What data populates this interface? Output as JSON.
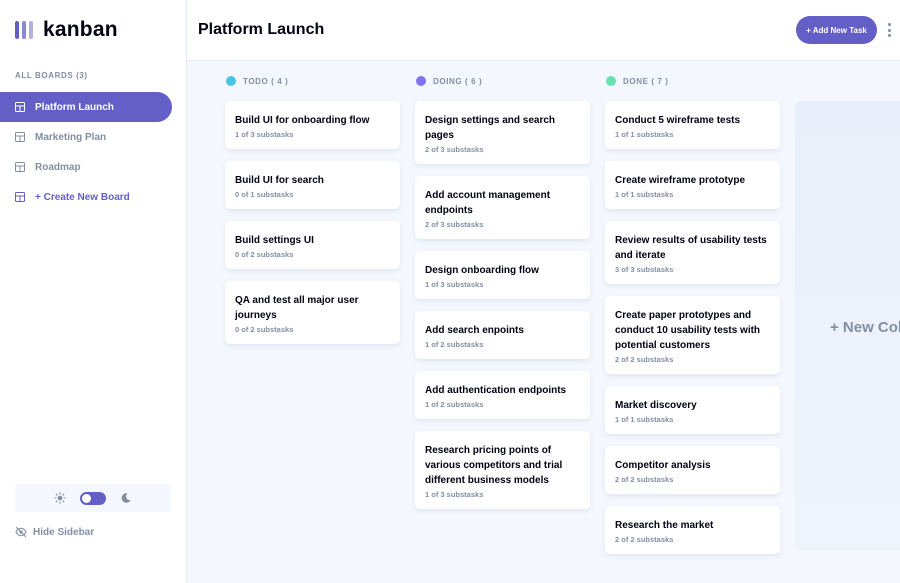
{
  "app": {
    "logo_text": "kanban"
  },
  "sidebar": {
    "boards_heading": "ALL BOARDS (3)",
    "boards": [
      {
        "label": "Platform Launch",
        "active": true
      },
      {
        "label": "Marketing Plan",
        "active": false
      },
      {
        "label": "Roadmap",
        "active": false
      }
    ],
    "create_label": "+ Create New Board",
    "hide_label": "Hide Sidebar"
  },
  "header": {
    "title": "Platform Launch",
    "add_task_label": "+ Add New Task"
  },
  "theme": {
    "mode": "light"
  },
  "columns": [
    {
      "title": "TODO ( 4 )",
      "color": "#49C4E5",
      "cards": [
        {
          "title": "Build UI for onboarding flow",
          "subtasks": "1 of 3 substasks"
        },
        {
          "title": "Build UI for search",
          "subtasks": "0 of 1 substasks"
        },
        {
          "title": "Build settings UI",
          "subtasks": "0 of 2 substasks"
        },
        {
          "title": "QA and test all major user journeys",
          "subtasks": "0 of 2 substasks"
        }
      ]
    },
    {
      "title": "DOING ( 6 )",
      "color": "#8471F2",
      "cards": [
        {
          "title": "Design settings and search pages",
          "subtasks": "2 of 3 substasks"
        },
        {
          "title": "Add account management endpoints",
          "subtasks": "2 of 3 substasks"
        },
        {
          "title": "Design onboarding flow",
          "subtasks": "1 of 3 substasks"
        },
        {
          "title": "Add search enpoints",
          "subtasks": "1 of 2 substasks"
        },
        {
          "title": "Add authentication endpoints",
          "subtasks": "1 of 2 substasks"
        },
        {
          "title": "Research pricing points of various competitors and trial different business models",
          "subtasks": "1 of 3 substasks"
        }
      ]
    },
    {
      "title": "DONE ( 7 )",
      "color": "#67E2AE",
      "cards": [
        {
          "title": "Conduct 5 wireframe tests",
          "subtasks": "1 of 1 substasks"
        },
        {
          "title": "Create wireframe prototype",
          "subtasks": "1 of 1 substasks"
        },
        {
          "title": "Review results of usability tests and iterate",
          "subtasks": "3 of 3 substasks"
        },
        {
          "title": "Create paper prototypes and conduct 10 usability tests with potential customers",
          "subtasks": "2 of 2 substasks"
        },
        {
          "title": "Market discovery",
          "subtasks": "1 of 1 substasks"
        },
        {
          "title": "Competitor analysis",
          "subtasks": "2 of 2 substasks"
        },
        {
          "title": "Research the market",
          "subtasks": "2 of 2 substasks"
        }
      ]
    }
  ],
  "new_column_label": "+ New Column",
  "colors": {
    "accent": "#635FC7",
    "muted": "#828FA3",
    "background": "#F4F7FD"
  }
}
